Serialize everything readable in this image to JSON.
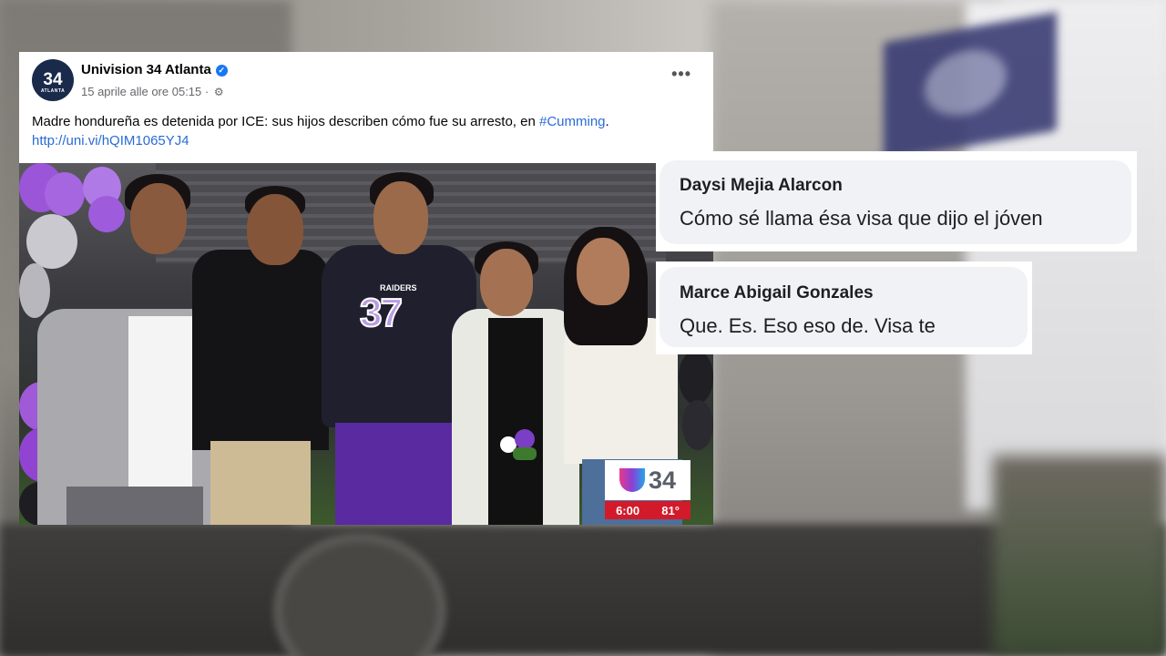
{
  "post": {
    "page_name": "Univision 34 Atlanta",
    "avatar_text": "34",
    "avatar_subtext": "ATLANTA",
    "timestamp": "15 aprile alle ore 05:15",
    "caption_text": "Madre hondureña es detenida por ICE: sus hijos describen cómo fue su arresto, en ",
    "caption_hashtag": "#Cumming",
    "caption_period": ".",
    "caption_link": "http://uni.vi/hQIM1065YJ4",
    "more_label": "•••",
    "photo": {
      "jersey_text": "RAIDERS",
      "jersey_number": "37"
    },
    "station_logo": {
      "channel": "34",
      "time": "6:00",
      "temperature": "81°"
    }
  },
  "comments": [
    {
      "author": "Daysi Mejia Alarcon",
      "text": "Cómo sé llama ésa visa que dijo el jóven"
    },
    {
      "author": "Marce Abigail Gonzales",
      "text": "Que. Es. Eso eso de. Visa te"
    }
  ],
  "colors": {
    "facebook_blue": "#1877f2",
    "link_blue": "#2a6bd6",
    "bubble_bg": "#f0f2f5",
    "univision_red": "#d31a2a"
  },
  "icons": [
    "verified-badge-icon",
    "globe-icon",
    "more-options-icon",
    "univision-logo-icon"
  ]
}
